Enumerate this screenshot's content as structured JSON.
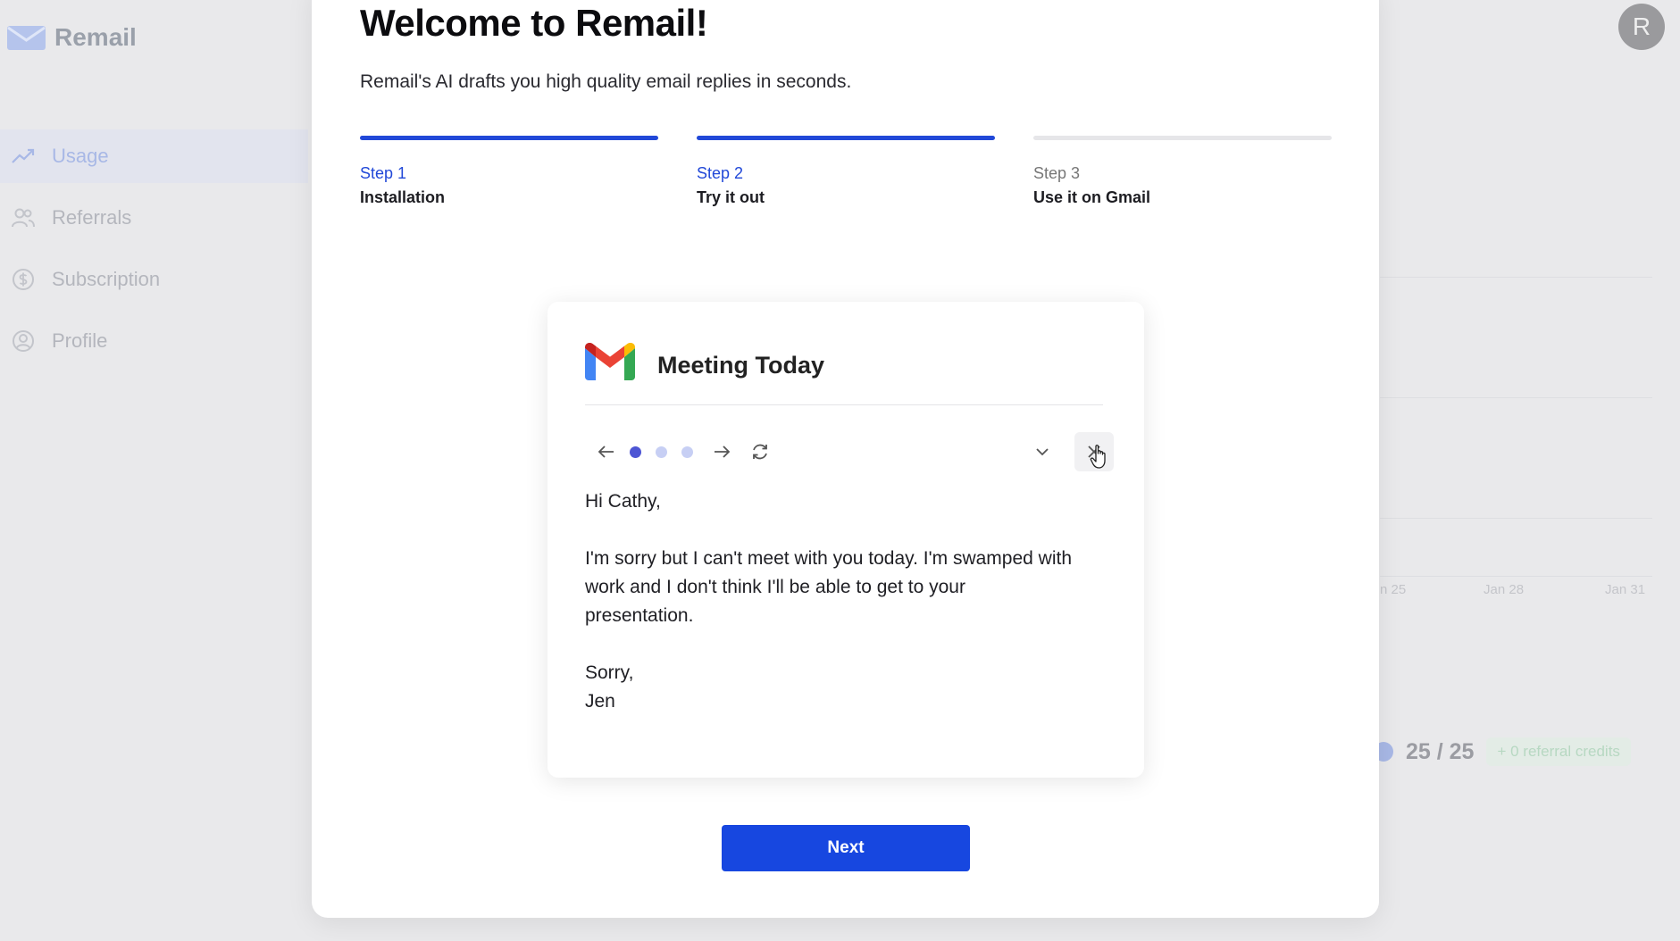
{
  "app": {
    "name": "Remail",
    "avatar_initial": "R"
  },
  "sidebar": {
    "items": [
      {
        "label": "Usage",
        "icon": "trending-up-icon",
        "active": true
      },
      {
        "label": "Referrals",
        "icon": "users-icon",
        "active": false
      },
      {
        "label": "Subscription",
        "icon": "dollar-circle-icon",
        "active": false
      },
      {
        "label": "Profile",
        "icon": "user-circle-icon",
        "active": false
      }
    ]
  },
  "background": {
    "chart_x_labels": [
      "n 25",
      "Jan 28",
      "Jan 31"
    ],
    "usage_count": "25 / 25",
    "referral_credits": "+ 0 referral credits"
  },
  "modal": {
    "title": "Welcome to Remail!",
    "subtitle": "Remail's AI drafts you high quality email replies in seconds.",
    "steps": [
      {
        "number": "Step 1",
        "name": "Installation",
        "done": true
      },
      {
        "number": "Step 2",
        "name": "Try it out",
        "done": true
      },
      {
        "number": "Step 3",
        "name": "Use it on Gmail",
        "done": false
      }
    ],
    "next_label": "Next"
  },
  "email_card": {
    "subject": "Meeting Today",
    "greeting": "Hi Cathy,",
    "body_lines": [
      "I'm sorry but I can't meet with you today. I'm swamped with",
      "work and I don't think I'll be able to get to your",
      "presentation."
    ],
    "closing": "Sorry,",
    "signature": "Jen",
    "draft_index": 1,
    "draft_total": 3
  },
  "colors": {
    "primary": "#1747e0",
    "step_active": "#2148d8",
    "dot_active": "#4d55d4",
    "dot_inactive": "#c7cff4"
  }
}
